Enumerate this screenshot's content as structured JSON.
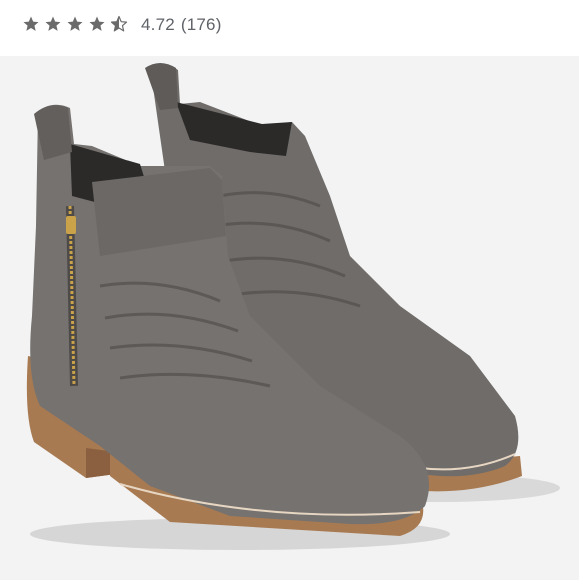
{
  "rating": {
    "value_text": "4.72",
    "count_text": "(176)",
    "stars": [
      {
        "name": "star-1-icon",
        "fill": 1
      },
      {
        "name": "star-2-icon",
        "fill": 1
      },
      {
        "name": "star-3-icon",
        "fill": 1
      },
      {
        "name": "star-4-icon",
        "fill": 1
      },
      {
        "name": "star-5-icon",
        "fill": 0.5
      }
    ],
    "star_color": "#6b6b6b"
  },
  "product_image": {
    "icon": "suede-ankle-boots-photo",
    "colors": {
      "suede": "#6f6c6a",
      "suede_dark": "#4f4c4a",
      "heel": "#a87a52",
      "zipper": "#c9a24a",
      "background": "#f3f3f3"
    }
  }
}
